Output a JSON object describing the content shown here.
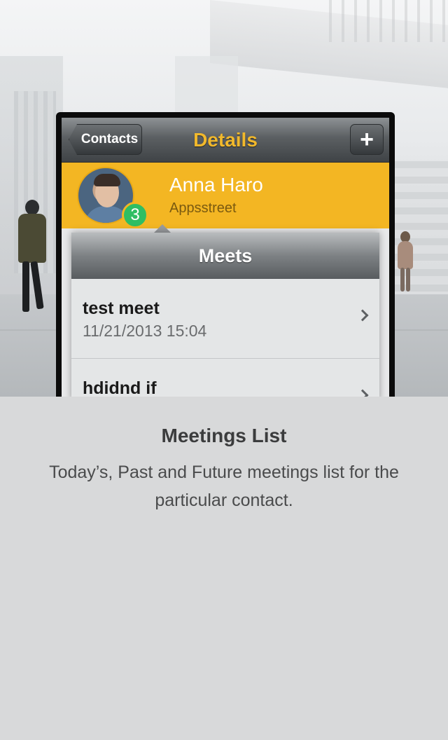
{
  "navbar": {
    "back_label": "Contacts",
    "title": "Details",
    "add_label": "+"
  },
  "contact": {
    "name": "Anna Haro",
    "company": "Appsstreet",
    "meet_count": "3"
  },
  "meets": {
    "header": "Meets",
    "items": [
      {
        "title": "test meet",
        "datetime": "11/21/2013 15:04"
      },
      {
        "title": "hdidnd if",
        "datetime": ""
      }
    ]
  },
  "caption": {
    "title": "Meetings List",
    "text": "Today’s, Past and Future meetings list for the particular contact."
  },
  "colors": {
    "accent": "#f3b623",
    "title": "#f1b82c",
    "badge": "#2fbe63"
  },
  "icons": {
    "add": "plus-icon",
    "row": "chevron-right-icon"
  }
}
